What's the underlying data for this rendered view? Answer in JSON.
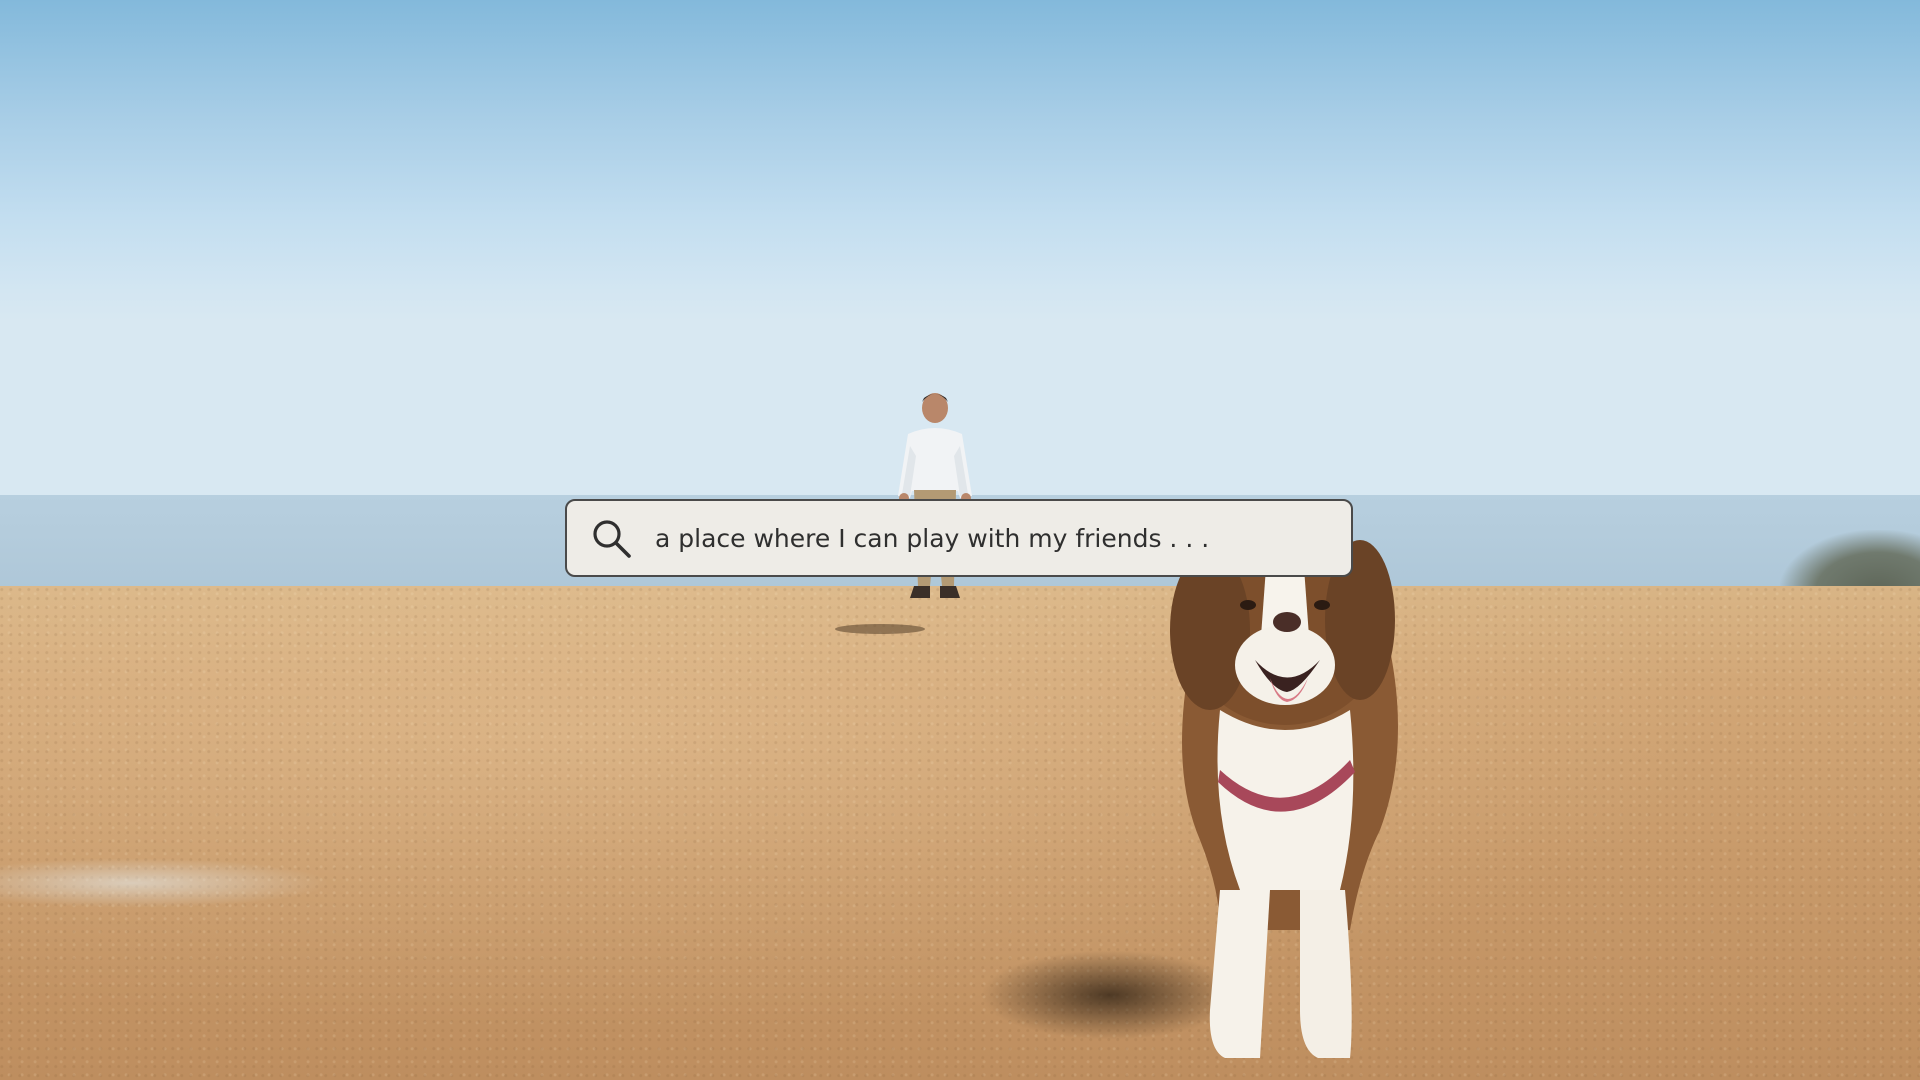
{
  "search": {
    "query": "a place where I can play with my friends . . .",
    "icon": "search-icon"
  },
  "colors": {
    "search_bar_bg": "#eeece7",
    "search_bar_border": "#4a4a4a",
    "sky_top": "#83b9db",
    "sand": "#d2a777"
  }
}
